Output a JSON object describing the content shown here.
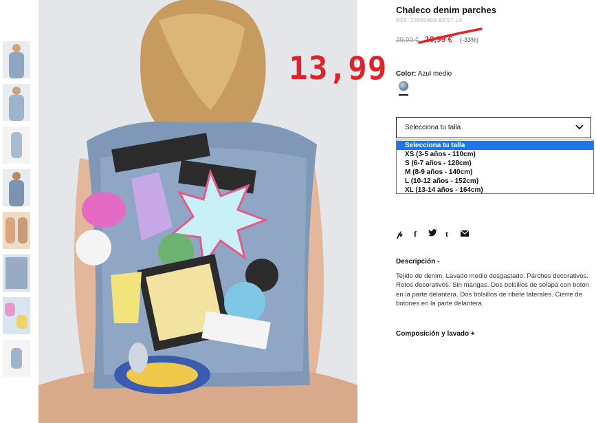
{
  "product": {
    "title": "Chaleco denim parches",
    "ref": "REF. 23095688-BEST-LA",
    "price_old": "29,99 €",
    "price_sale": "19,99 €",
    "discount": "(-33%)",
    "handwritten_price": "13,99"
  },
  "color": {
    "label": "Color:",
    "value": "Azul medio"
  },
  "size_select": {
    "current": "Selecciona tu talla",
    "options": [
      "Selecciona tu talla",
      "XS (3-5 años - 110cm)",
      "S (6-7 años - 128cm)",
      "M (8-9 años - 140cm)",
      "L (10-12 años - 152cm)",
      "XL (13-14 años - 164cm)"
    ]
  },
  "social_icons": [
    "pinterest-icon",
    "facebook-icon",
    "twitter-icon",
    "tumblr-icon",
    "mail-icon"
  ],
  "description": {
    "heading": "Descripción -",
    "text": "Tejido de denim. Lavado medio desgastado. Parches decorativos. Rotos decorativos. Sin mangas. Dos bolsillos de solapa con botón en la parte delantera. Dos bolsillos de ribete laterales. Cierre de botones en la parte delantera."
  },
  "composition": {
    "heading": "Composición y lavado +"
  },
  "colors": {
    "accent_red": "#e0232b",
    "selected_blue": "#1e77e6"
  }
}
